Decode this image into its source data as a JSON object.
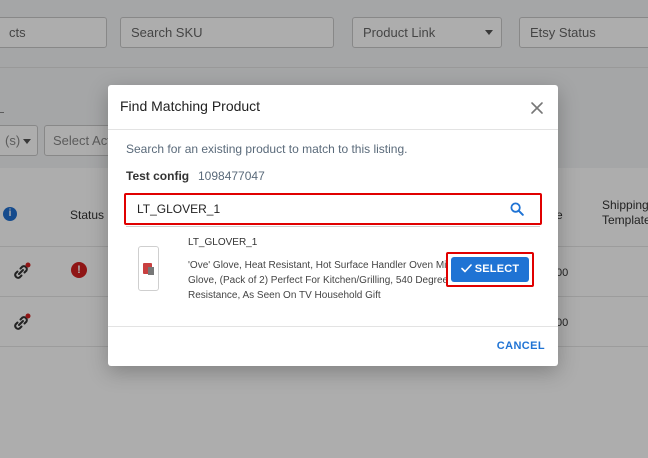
{
  "filters": {
    "products_partial": "cts",
    "sku_placeholder": "Search SKU",
    "product_link": "Product Link",
    "etsy_status": "Etsy Status"
  },
  "bulk": {
    "selected_partial": "(s)",
    "select_action_partial": "Select Act"
  },
  "table": {
    "status_header": "Status",
    "price_partial": "e",
    "shipping_header_line1": "Shipping",
    "shipping_header_line2": "Template",
    "row1_value_partial": "00",
    "row2_value_partial": "00"
  },
  "modal": {
    "title": "Find Matching Product",
    "description": "Search for an existing product to match to this listing.",
    "config_label": "Test config",
    "config_value": "1098477047",
    "search_value": "LT_GLOVER_1",
    "result": {
      "sku": "LT_GLOVER_1",
      "title": "'Ove' Glove, Heat Resistant, Hot Surface Handler Oven Mitt/Grilling Glove, (Pack of 2) Perfect For Kitchen/Grilling, 540 Degree Resistance, As Seen On TV Household Gift"
    },
    "select_label": "SELECT",
    "cancel_label": "CANCEL"
  },
  "colors": {
    "accent": "#1f73d4",
    "highlight": "#e00000",
    "error": "#d32020"
  },
  "icons": [
    "close-icon",
    "search-icon",
    "check-icon",
    "link-icon",
    "error-icon",
    "info-icon",
    "chevron-down-icon"
  ]
}
